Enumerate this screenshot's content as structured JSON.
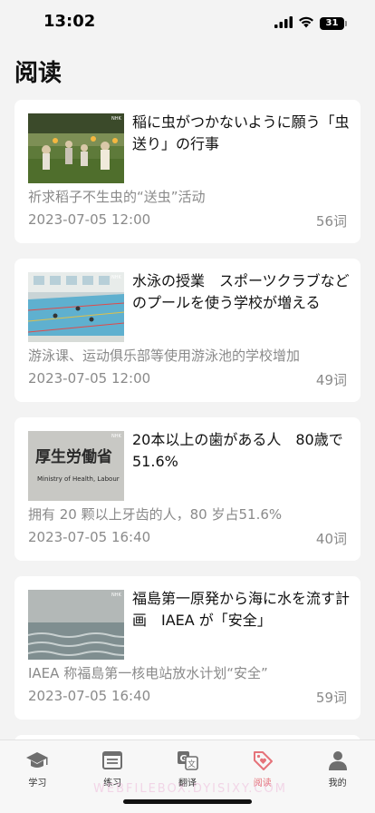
{
  "status_bar": {
    "time": "13:02",
    "battery": "31"
  },
  "page": {
    "title": "阅读"
  },
  "articles": [
    {
      "title": "稲に虫がつかないように願う「虫送り」の行事",
      "translation": "祈求稻子不生虫的“送虫”活动",
      "date": "2023-07-05 12:00",
      "word_count": "56词",
      "thumbnail": "rice-field-festival-image"
    },
    {
      "title": "水泳の授業　スポーツクラブなどのプールを使う学校が増える",
      "translation": "游泳课、运动俱乐部等使用游泳池的学校增加",
      "date": "2023-07-05 12:00",
      "word_count": "49词",
      "thumbnail": "swimming-pool-image"
    },
    {
      "title": "20本以上の歯がある人　80歳で51.6%",
      "translation": "拥有 20 颗以上牙齿的人，80 岁占51.6%",
      "date": "2023-07-05 16:40",
      "word_count": "40词",
      "thumbnail": "ministry-sign-image",
      "thumbnail_text": {
        "line1": "厚生労働省",
        "line2": "Ministry of Health, Labour"
      }
    },
    {
      "title": "福島第一原発から海に水を流す計画　IAEA が「安全」",
      "translation": "IAEA 称福島第一核电站放水计划“安全”",
      "date": "2023-07-05 16:40",
      "word_count": "59词",
      "thumbnail": "sea-water-image"
    }
  ],
  "tabs": [
    {
      "label": "学习",
      "icon": "graduation-cap-icon",
      "active": false
    },
    {
      "label": "练习",
      "icon": "notebook-icon",
      "active": false
    },
    {
      "label": "翻译",
      "icon": "translate-icon",
      "active": false
    },
    {
      "label": "阅读",
      "icon": "tag-heart-icon",
      "active": true
    },
    {
      "label": "我的",
      "icon": "person-icon",
      "active": false
    }
  ],
  "watermark": "WEBFILEBOX.DYISIXY.COM",
  "colors": {
    "accent": "#e5737a",
    "background": "#f3f3f3",
    "secondary_text": "#8a8a8a"
  }
}
